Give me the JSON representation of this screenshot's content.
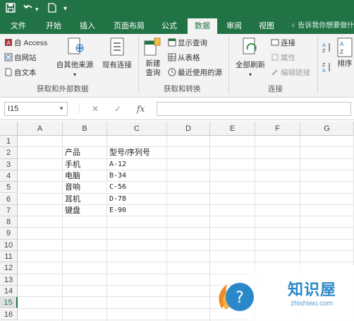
{
  "tabs": [
    {
      "label": "文件"
    },
    {
      "label": "开始"
    },
    {
      "label": "插入"
    },
    {
      "label": "页面布局"
    },
    {
      "label": "公式"
    },
    {
      "label": "数据"
    },
    {
      "label": "审阅"
    },
    {
      "label": "视图"
    }
  ],
  "tell_me": "告诉我你想要做什么",
  "ribbon": {
    "get_external": {
      "access": "自 Access",
      "web": "自网站",
      "text": "自文本",
      "other_line1": "自其他来源",
      "existing": "现有连接",
      "label": "获取和外部数据"
    },
    "transform": {
      "new_query_line1": "新建",
      "new_query_line2": "查询",
      "show_queries": "显示查询",
      "from_table": "从表格",
      "recent_sources": "最近使用的源",
      "label": "获取和转换"
    },
    "connections": {
      "refresh_all": "全部刷新",
      "connections": "连接",
      "properties": "属性",
      "edit_links": "编辑链接",
      "label": "连接"
    },
    "sort": {
      "sort_label": "排序"
    }
  },
  "formula_bar": {
    "name_box": "I15",
    "fx": "fx",
    "value": ""
  },
  "grid": {
    "columns": [
      "A",
      "B",
      "C",
      "D",
      "E",
      "F",
      "G"
    ],
    "rows": [
      "1",
      "2",
      "3",
      "4",
      "5",
      "6",
      "7",
      "8",
      "9",
      "10",
      "11",
      "12",
      "13",
      "14",
      "15",
      "16"
    ],
    "selected_row": "15",
    "cells": {
      "B2": "产品",
      "C2": "型号/序列号",
      "B3": "手机",
      "C3": "A-12",
      "B4": "电脑",
      "C4": "B-34",
      "B5": "音响",
      "C5": "C-56",
      "B6": "耳机",
      "C6": "D-78",
      "B7": "键盘",
      "C7": "E-90"
    }
  },
  "watermark": {
    "name": "知识屋",
    "url": "zhishiwu.com"
  }
}
